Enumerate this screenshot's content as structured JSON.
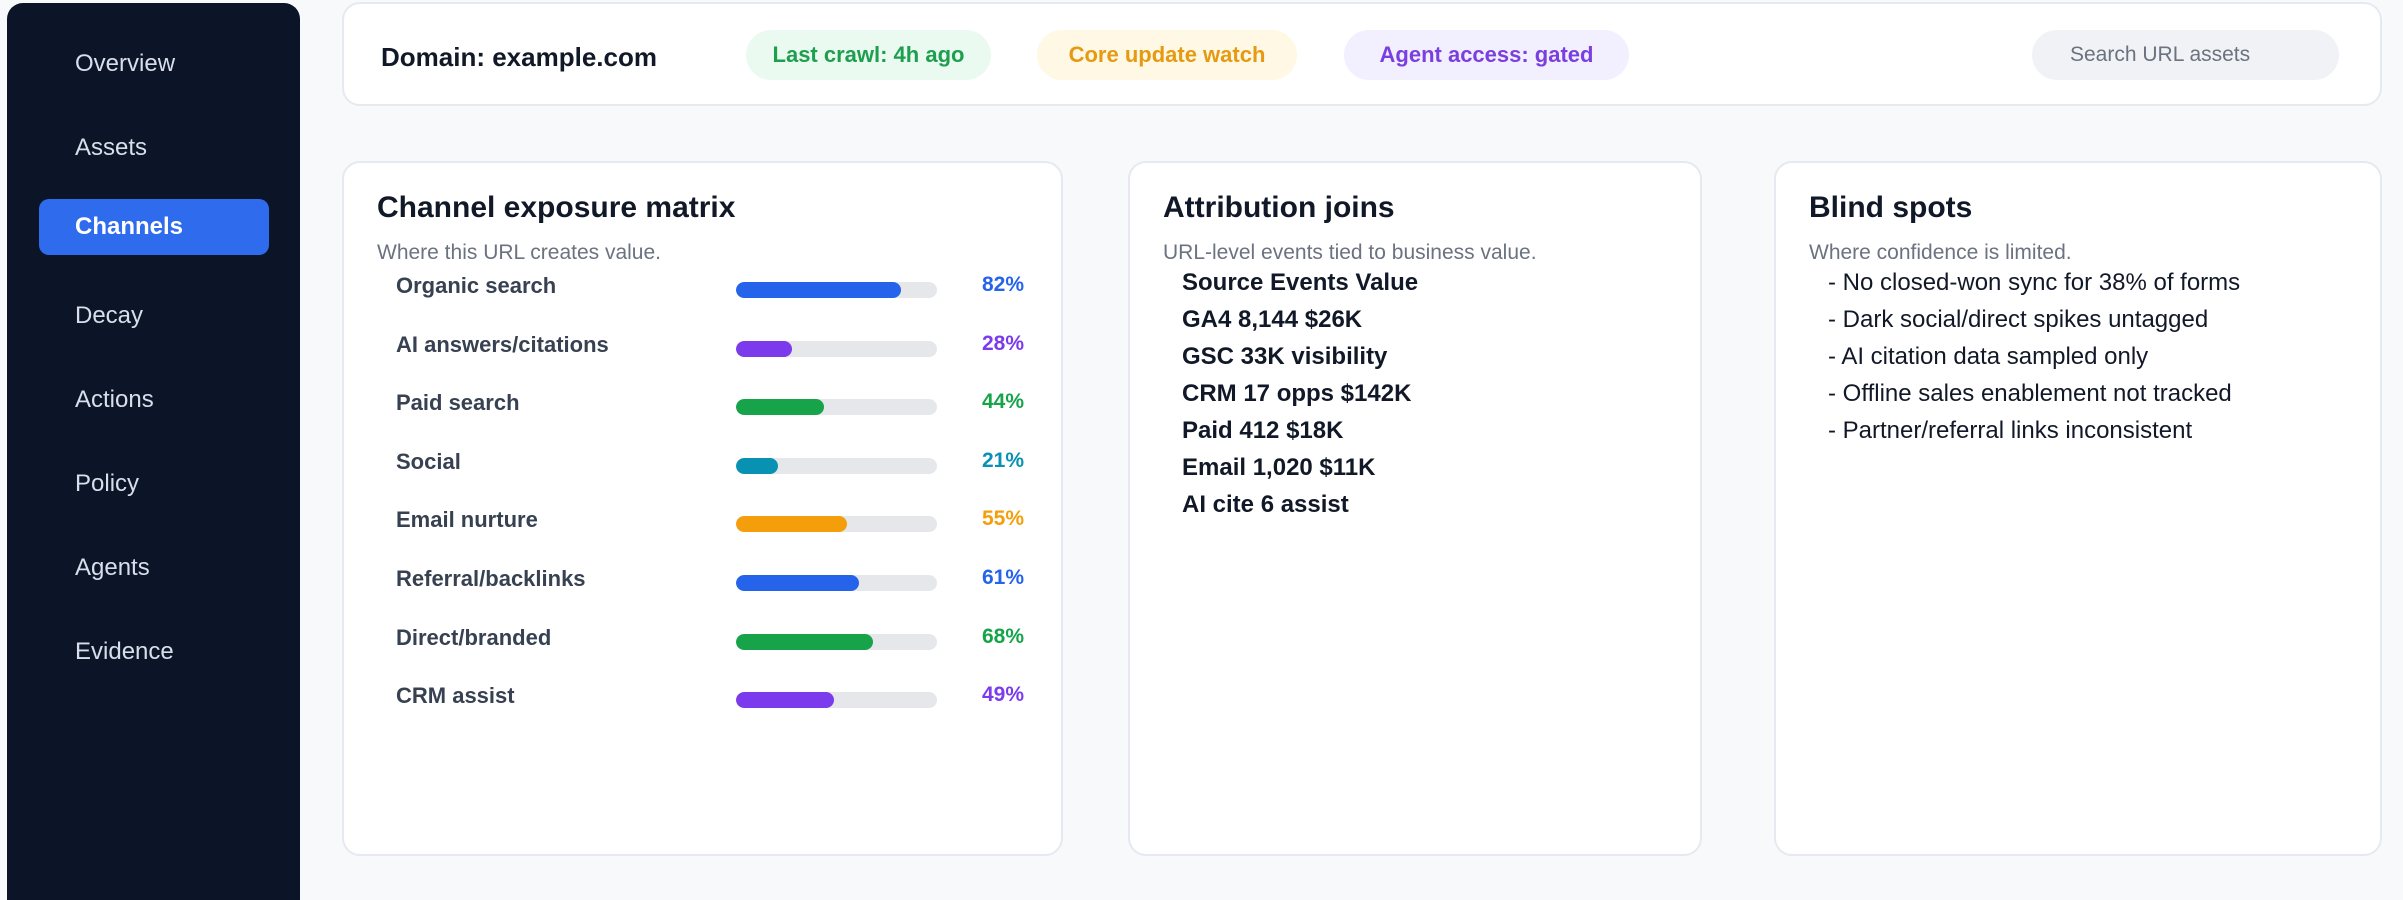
{
  "sidebar": {
    "items": [
      {
        "label": "Overview"
      },
      {
        "label": "Assets"
      },
      {
        "label": "Channels"
      },
      {
        "label": "Decay"
      },
      {
        "label": "Actions"
      },
      {
        "label": "Policy"
      },
      {
        "label": "Agents"
      },
      {
        "label": "Evidence"
      }
    ],
    "active": "Channels"
  },
  "header": {
    "domain": "Domain: example.com",
    "badges": {
      "crawl": "Last crawl: 4h ago",
      "core": "Core update watch",
      "agent": "Agent access: gated"
    },
    "search_placeholder": "Search URL assets"
  },
  "exposure": {
    "title": "Channel exposure matrix",
    "subtitle": "Where this URL creates value.",
    "rows": [
      {
        "label": "Organic search",
        "value": "82%",
        "pct": 82,
        "color": "#2563eb"
      },
      {
        "label": "AI answers/citations",
        "value": "28%",
        "pct": 28,
        "color": "#7c3aed"
      },
      {
        "label": "Paid search",
        "value": "44%",
        "pct": 44,
        "color": "#16a34a"
      },
      {
        "label": "Social",
        "value": "21%",
        "pct": 21,
        "color": "#0891b2"
      },
      {
        "label": "Email nurture",
        "value": "55%",
        "pct": 55,
        "color": "#f59e0b"
      },
      {
        "label": "Referral/backlinks",
        "value": "61%",
        "pct": 61,
        "color": "#2563eb"
      },
      {
        "label": "Direct/branded",
        "value": "68%",
        "pct": 68,
        "color": "#16a34a"
      },
      {
        "label": "CRM assist",
        "value": "49%",
        "pct": 49,
        "color": "#7c3aed"
      }
    ]
  },
  "attribution": {
    "title": "Attribution joins",
    "subtitle": "URL-level events tied to business value.",
    "lines": [
      "Source Events Value",
      "GA4 8,144 $26K",
      "GSC 33K visibility",
      "CRM 17 opps $142K",
      "Paid 412 $18K",
      "Email 1,020 $11K",
      "AI cite 6 assist"
    ]
  },
  "blind": {
    "title": "Blind spots",
    "subtitle": "Where confidence is limited.",
    "lines": [
      "- No closed-won sync for 38% of forms",
      "- Dark social/direct spikes untagged",
      "- AI citation data sampled only",
      "- Offline sales enablement not tracked",
      "- Partner/referral links inconsistent"
    ]
  }
}
